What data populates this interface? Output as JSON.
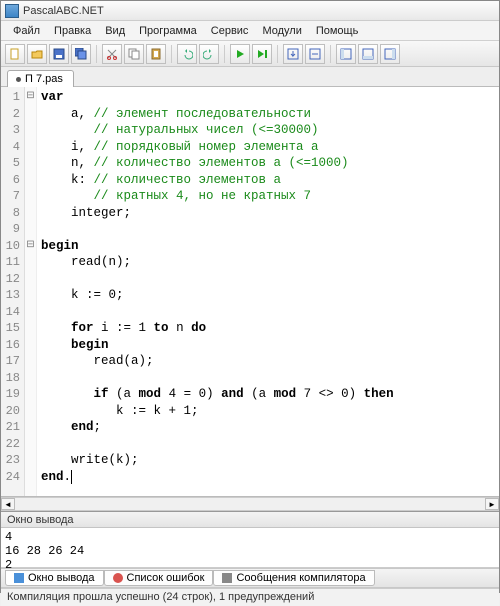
{
  "app": {
    "title": "PascalABC.NET"
  },
  "menu": {
    "items": [
      "Файл",
      "Правка",
      "Вид",
      "Программа",
      "Сервис",
      "Модули",
      "Помощь"
    ]
  },
  "tab": {
    "label": "П 7.pas"
  },
  "code": {
    "lines": [
      {
        "n": 1,
        "fold": "⊟",
        "kw1": "var",
        "rest": ""
      },
      {
        "n": 2,
        "fold": "",
        "pre": "    a, ",
        "cm": "// элемент последовательности"
      },
      {
        "n": 3,
        "fold": "",
        "pre": "       ",
        "cm": "// натуральных чисел (<=30000)"
      },
      {
        "n": 4,
        "fold": "",
        "pre": "    i, ",
        "cm": "// порядковый номер элемента a"
      },
      {
        "n": 5,
        "fold": "",
        "pre": "    n, ",
        "cm": "// количество элементов a (<=1000)"
      },
      {
        "n": 6,
        "fold": "",
        "pre": "    k: ",
        "cm": "// количество элементов a"
      },
      {
        "n": 7,
        "fold": "",
        "pre": "       ",
        "cm": "// кратных 4, но не кратных 7"
      },
      {
        "n": 8,
        "fold": "",
        "pre": "    integer;"
      },
      {
        "n": 9,
        "fold": "",
        "pre": ""
      },
      {
        "n": 10,
        "fold": "⊟",
        "kw1": "begin"
      },
      {
        "n": 11,
        "fold": "",
        "pre": "    read(n);"
      },
      {
        "n": 12,
        "fold": "",
        "pre": ""
      },
      {
        "n": 13,
        "fold": "",
        "pre": "    k := 0;"
      },
      {
        "n": 14,
        "fold": "",
        "pre": ""
      },
      {
        "n": 15,
        "fold": "",
        "pre": "    ",
        "kw1": "for",
        "mid": " i := 1 ",
        "kw2": "to",
        "mid2": " n ",
        "kw3": "do"
      },
      {
        "n": 16,
        "fold": "",
        "pre": "    ",
        "kw1": "begin"
      },
      {
        "n": 17,
        "fold": "",
        "pre": "       read(a);"
      },
      {
        "n": 18,
        "fold": "",
        "pre": ""
      },
      {
        "n": 19,
        "fold": "",
        "pre": "       ",
        "kw1": "if",
        "mid": " (a ",
        "kw2": "mod",
        "mid2": " 4 = 0) ",
        "kw3": "and",
        "mid3": " (a ",
        "kw4": "mod",
        "mid4": " 7 <> 0) ",
        "kw5": "then"
      },
      {
        "n": 20,
        "fold": "",
        "pre": "          k := k + 1;"
      },
      {
        "n": 21,
        "fold": "",
        "pre": "    ",
        "kw1": "end",
        ";": ";"
      },
      {
        "n": 22,
        "fold": "",
        "pre": ""
      },
      {
        "n": 23,
        "fold": "",
        "pre": "    write(k);"
      },
      {
        "n": 24,
        "fold": "",
        "kw1": "end",
        "dot": "."
      }
    ]
  },
  "output": {
    "title": "Окно вывода",
    "text": "4\n16 28 26 24\n2"
  },
  "bottomTabs": {
    "items": [
      {
        "label": "Окно вывода",
        "color": "#4a90d9"
      },
      {
        "label": "Список ошибок",
        "color": "#d9534f"
      },
      {
        "label": "Сообщения компилятора",
        "color": "#888"
      }
    ]
  },
  "status": {
    "text": "Компиляция прошла успешно (24 строк), 1 предупреждений"
  }
}
